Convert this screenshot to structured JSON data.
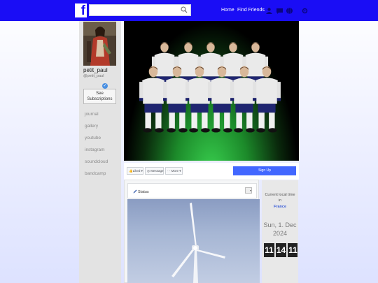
{
  "topbar": {
    "logo": "f",
    "search": {
      "value": "",
      "placeholder": ""
    },
    "nav": {
      "home": "Home",
      "find_friends": "Find Friends"
    },
    "icons": [
      "friend-requests-icon",
      "messages-icon",
      "globe-icon",
      "settings-icon"
    ]
  },
  "colors": {
    "topbar": "#1a0df5",
    "signup": "#4267ff",
    "country": "#3b5fd8"
  },
  "profile": {
    "name": "petit_paul",
    "handle": "@petit_paul",
    "subscriptions_button": [
      "See",
      "Subscriptions"
    ],
    "links": [
      "journal",
      "gallery",
      "youtube",
      "instagram",
      "soundcloud",
      "bandcamp"
    ]
  },
  "actions": {
    "liked": "Liked",
    "message": "Message",
    "more": "More",
    "signup": "Sign Up"
  },
  "status": {
    "title": "Status"
  },
  "clock": {
    "label": "Current local time in",
    "country": "France",
    "date_line1": "Sun, 1. Dec",
    "date_line2": "2024",
    "digits": [
      "11",
      "14",
      "11"
    ]
  }
}
